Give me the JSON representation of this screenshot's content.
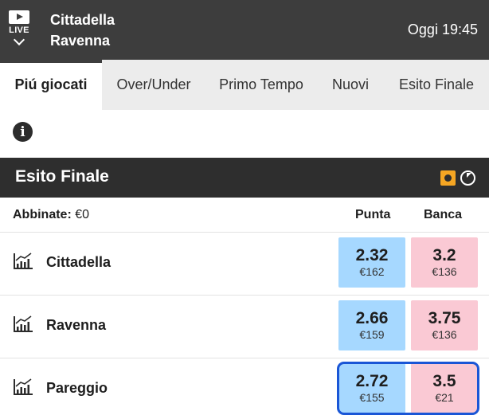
{
  "header": {
    "live_label": "LIVE",
    "home_team": "Cittadella",
    "away_team": "Ravenna",
    "datetime": "Oggi 19:45"
  },
  "tabs": [
    {
      "label": "Piú giocati",
      "active": true
    },
    {
      "label": "Over/Under",
      "active": false
    },
    {
      "label": "Primo Tempo",
      "active": false
    },
    {
      "label": "Nuovi",
      "active": false
    },
    {
      "label": "Esito Finale",
      "active": false
    }
  ],
  "market": {
    "title": "Esito Finale",
    "matched_label": "Abbinate:",
    "matched_value": "€0",
    "back_header": "Punta",
    "lay_header": "Banca"
  },
  "runners": [
    {
      "name": "Cittadella",
      "back_price": "2.32",
      "back_stake": "€162",
      "lay_price": "3.2",
      "lay_stake": "€136"
    },
    {
      "name": "Ravenna",
      "back_price": "2.66",
      "back_stake": "€159",
      "lay_price": "3.75",
      "lay_stake": "€136"
    },
    {
      "name": "Pareggio",
      "back_price": "2.72",
      "back_stake": "€155",
      "lay_price": "3.5",
      "lay_stake": "€21"
    }
  ],
  "icons": {
    "live": "play-icon",
    "expand": "chevron-down-icon",
    "info": "info-icon",
    "inplay": "inplay-icon",
    "clock": "timer-icon",
    "chart": "chart-icon"
  },
  "colors": {
    "header_bg": "#3d3d3d",
    "back": "#a6d8ff",
    "lay": "#fac9d4",
    "accent": "#f5a623",
    "selected": "#1a56d6"
  }
}
